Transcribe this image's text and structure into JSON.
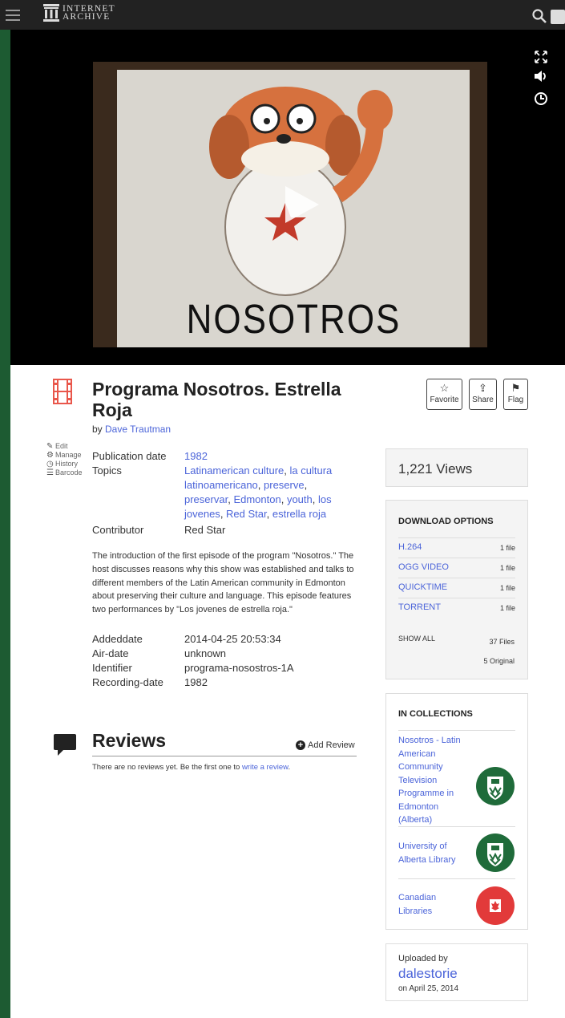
{
  "nav": {
    "logo_line1": "INTERNET",
    "logo_line2": "ARCHIVE"
  },
  "player": {
    "poster_text": "NOSOTROS"
  },
  "item": {
    "title": "Programa Nosotros. Estrella Roja",
    "by_prefix": "by ",
    "creator": "Dave Trautman"
  },
  "actions": {
    "favorite": "Favorite",
    "share": "Share",
    "flag": "Flag"
  },
  "side_links": {
    "edit": "Edit",
    "manage": "Manage",
    "history": "History",
    "barcode": "Barcode"
  },
  "metadata": {
    "publication_date_label": "Publication date",
    "publication_date": "1982",
    "topics_label": "Topics",
    "topics": [
      "Latinamerican culture",
      "la cultura latinoamericano",
      "preserve",
      "preservar",
      "Edmonton",
      "youth",
      "los jovenes",
      "Red Star",
      "estrella roja"
    ],
    "contributor_label": "Contributor",
    "contributor": "Red Star"
  },
  "description": "The introduction of the first episode of the program \"Nosotros.\" The host discusses reasons why this show was established and talks to different members of the Latin American community in Edmonton about preserving their culture and language. This episode features two performances by \"Los jovenes de estrella roja.\"",
  "details": [
    {
      "label": "Addeddate",
      "value": "2014-04-25 20:53:34"
    },
    {
      "label": "Air-date",
      "value": "unknown"
    },
    {
      "label": "Identifier",
      "value": "programa-nosostros-1A"
    },
    {
      "label": "Recording-date",
      "value": "1982"
    }
  ],
  "reviews": {
    "title": "Reviews",
    "add_label": "Add Review",
    "empty_prefix": "There are no reviews yet. Be the first one to ",
    "empty_link": "write a review",
    "empty_suffix": "."
  },
  "views": "1,221 Views",
  "downloads": {
    "heading": "DOWNLOAD OPTIONS",
    "formats": [
      {
        "name": "H.264",
        "count": "1 file"
      },
      {
        "name": "OGG VIDEO",
        "count": "1 file"
      },
      {
        "name": "QUICKTIME",
        "count": "1 file"
      },
      {
        "name": "TORRENT",
        "count": "1 file"
      }
    ],
    "show_all": "SHOW ALL",
    "total_files": "37 Files",
    "original_files": "5 Original"
  },
  "collections": {
    "heading": "IN COLLECTIONS",
    "items": [
      {
        "name": "Nosotros - Latin American Community Television Programme in Edmonton (Alberta)",
        "logo": "ualberta-shield-icon"
      },
      {
        "name": "University of Alberta Library",
        "logo": "ualberta-shield-icon"
      },
      {
        "name": "Canadian Libraries",
        "logo": "canada-flag-icon"
      }
    ]
  },
  "uploader": {
    "label": "Uploaded by",
    "name": "dalestorie",
    "date": "on April 25, 2014"
  },
  "colors": {
    "link": "#4b64d9",
    "film_icon": "#e9574b",
    "ualberta_green": "#1f6b3a",
    "canada_red": "#e23a3a"
  }
}
